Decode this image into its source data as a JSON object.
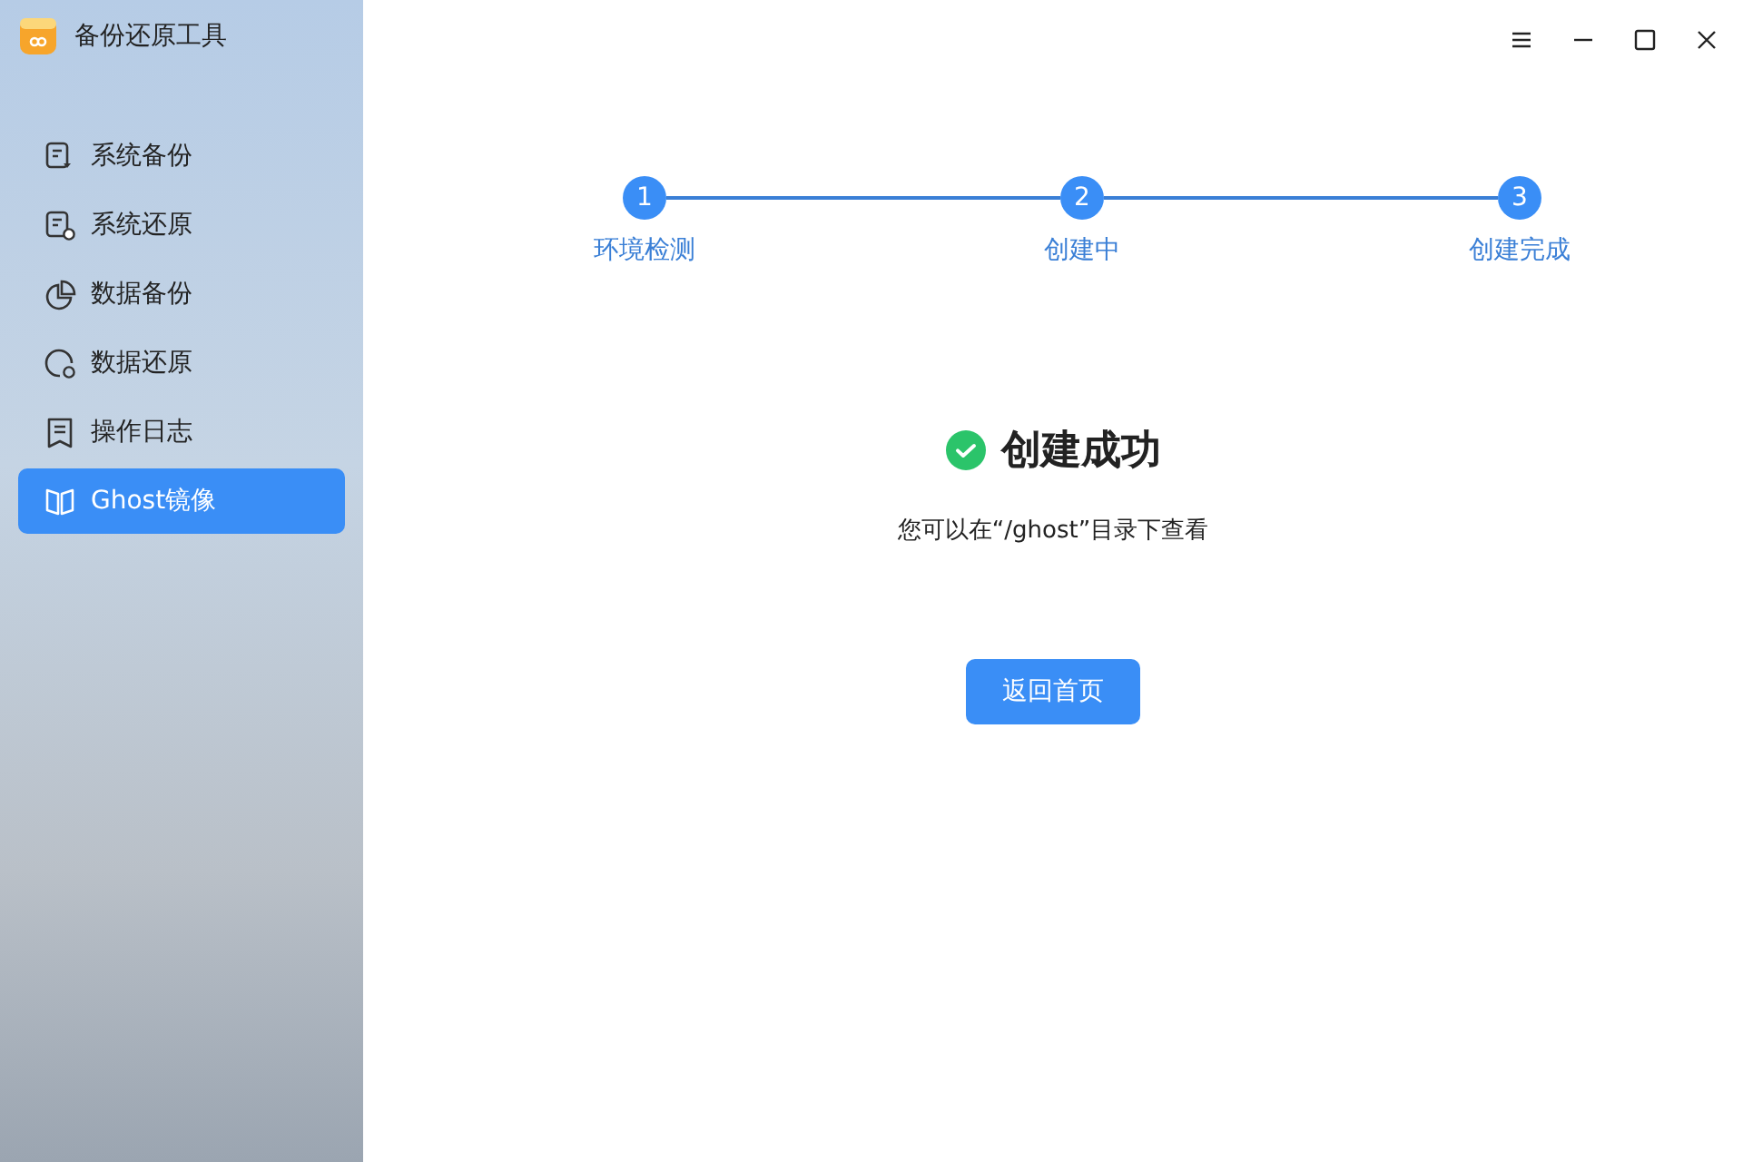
{
  "window": {
    "title": "备份还原工具"
  },
  "sidebar": {
    "items": [
      {
        "label": "系统备份",
        "kind": "sysbackup",
        "selected": false
      },
      {
        "label": "系统还原",
        "kind": "sysrestore",
        "selected": false
      },
      {
        "label": "数据备份",
        "kind": "databackup",
        "selected": false
      },
      {
        "label": "数据还原",
        "kind": "datarestore",
        "selected": false
      },
      {
        "label": "操作日志",
        "kind": "log",
        "selected": false
      },
      {
        "label": "Ghost镜像",
        "kind": "ghost",
        "selected": true
      }
    ]
  },
  "steps": [
    {
      "number": "1",
      "label": "环境检测",
      "done": true
    },
    {
      "number": "2",
      "label": "创建中",
      "done": true
    },
    {
      "number": "3",
      "label": "创建完成",
      "done": true
    }
  ],
  "result": {
    "title": "创建成功",
    "message": "您可以在“/ghost”目录下查看",
    "button": "返回首页"
  }
}
